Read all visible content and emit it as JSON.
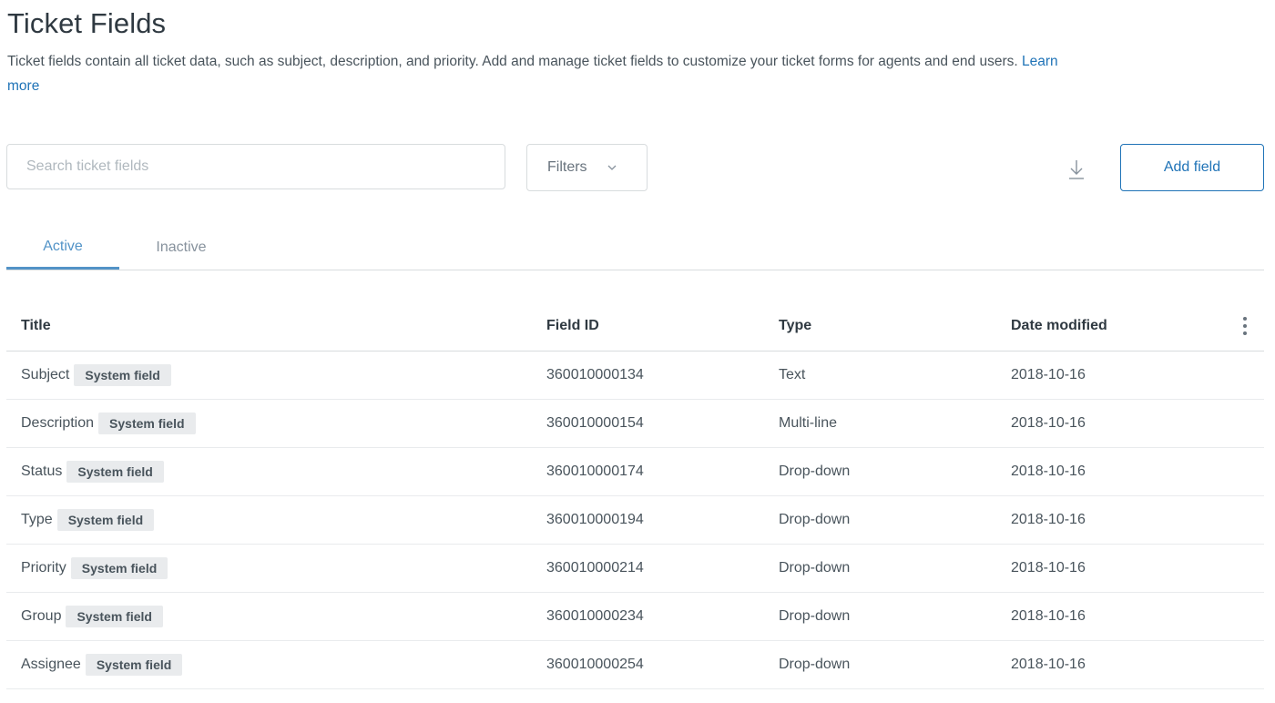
{
  "page": {
    "title": "Ticket Fields",
    "description": "Ticket fields contain all ticket data, such as subject, description, and priority. Add and manage ticket fields to customize your ticket forms for agents and end users.",
    "learn_more": "Learn more"
  },
  "toolbar": {
    "search_placeholder": "Search ticket fields",
    "filters_label": "Filters",
    "add_field_label": "Add field"
  },
  "tabs": [
    {
      "label": "Active",
      "selected": true
    },
    {
      "label": "Inactive",
      "selected": false
    }
  ],
  "table": {
    "columns": [
      "Title",
      "Field ID",
      "Type",
      "Date modified"
    ],
    "rows": [
      {
        "title": "Subject",
        "badge": "System field",
        "field_id": "360010000134",
        "type": "Text",
        "date": "2018-10-16"
      },
      {
        "title": "Description",
        "badge": "System field",
        "field_id": "360010000154",
        "type": "Multi-line",
        "date": "2018-10-16"
      },
      {
        "title": "Status",
        "badge": "System field",
        "field_id": "360010000174",
        "type": "Drop-down",
        "date": "2018-10-16"
      },
      {
        "title": "Type",
        "badge": "System field",
        "field_id": "360010000194",
        "type": "Drop-down",
        "date": "2018-10-16"
      },
      {
        "title": "Priority",
        "badge": "System field",
        "field_id": "360010000214",
        "type": "Drop-down",
        "date": "2018-10-16"
      },
      {
        "title": "Group",
        "badge": "System field",
        "field_id": "360010000234",
        "type": "Drop-down",
        "date": "2018-10-16"
      },
      {
        "title": "Assignee",
        "badge": "System field",
        "field_id": "360010000254",
        "type": "Drop-down",
        "date": "2018-10-16"
      }
    ]
  },
  "icons": {
    "filters_chevron": "chevron-down-icon",
    "download": "download-icon",
    "column_menu": "more-vertical-icon"
  },
  "colors": {
    "accent": "#1f73b7",
    "tab_active": "#5293c7",
    "badge_bg": "#e9ebed"
  }
}
